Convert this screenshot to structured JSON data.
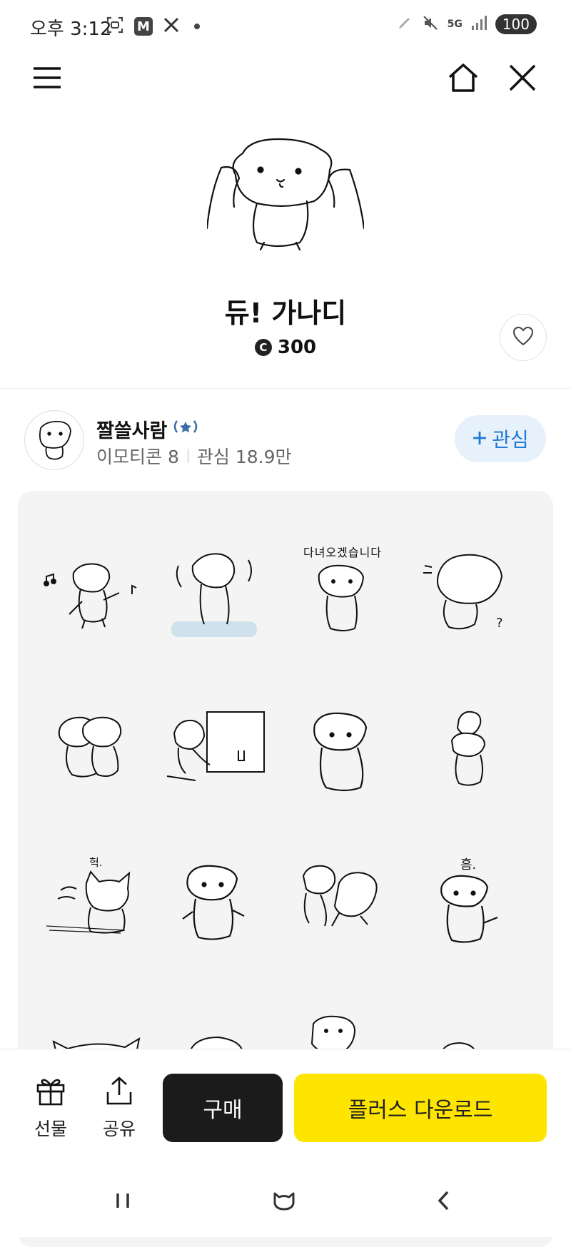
{
  "status_bar": {
    "time": "오후 3:12",
    "icon_m": "M",
    "network": "5G",
    "battery": "100"
  },
  "nav": {
    "menu_icon": "menu-icon",
    "home_icon": "home-icon",
    "close_icon": "close-icon"
  },
  "product": {
    "title": "듀! 가나디",
    "coin_symbol": "C",
    "price": "300"
  },
  "author": {
    "name": "짤쓸사람",
    "emoticon_count": "이모티콘 8",
    "followers": "관심 18.9만",
    "follow_label": "관심"
  },
  "stickers": [
    {
      "caption": ""
    },
    {
      "caption": ""
    },
    {
      "caption": "다녀오겠습니다"
    },
    {
      "caption": "?"
    },
    {
      "caption": ""
    },
    {
      "caption": ""
    },
    {
      "caption": ""
    },
    {
      "caption": ""
    },
    {
      "caption": "헉."
    },
    {
      "caption": ""
    },
    {
      "caption": ""
    },
    {
      "caption": "흠."
    }
  ],
  "bottom_bar": {
    "gift_label": "선물",
    "share_label": "공유",
    "buy_label": "구매",
    "plus_label": "플러스 다운로드"
  },
  "colors": {
    "accent_yellow": "#fee500",
    "follow_blue": "#1f7ad2",
    "follow_bg": "#e6f1fb",
    "buy_black": "#1b1b1b"
  }
}
